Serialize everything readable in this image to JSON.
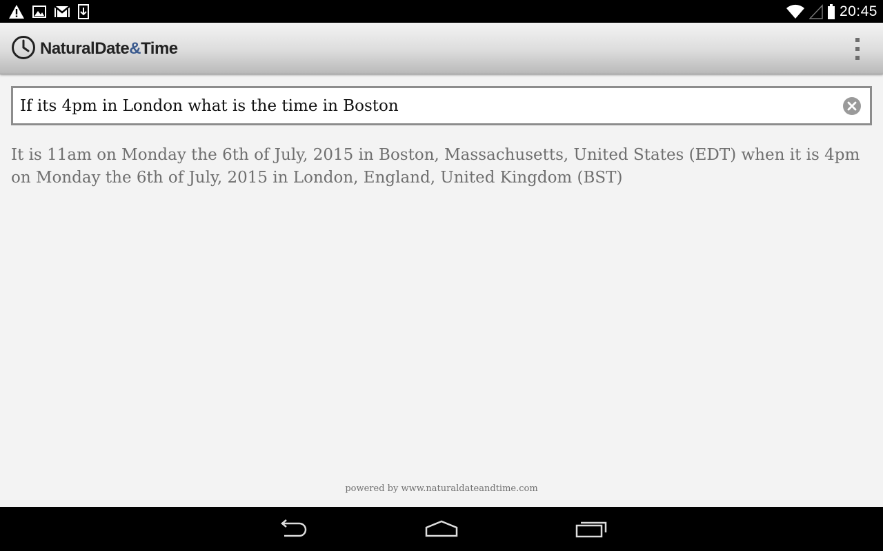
{
  "status_bar": {
    "time": "20:45",
    "left_icons": [
      "warning-icon",
      "image-icon",
      "gmail-icon",
      "download-icon"
    ],
    "right_icons": [
      "wifi-icon",
      "cell-signal-icon",
      "battery-icon"
    ]
  },
  "app_bar": {
    "title_main": "NaturalDate",
    "title_amp": "&",
    "title_end": "Time",
    "logo_icon": "clock-icon",
    "menu_icon": "overflow-menu-icon"
  },
  "search": {
    "value": "If its 4pm in London what is the time in Boston",
    "clear_icon": "clear-icon"
  },
  "result": {
    "text": "It is 11am on Monday the 6th of July, 2015 in Boston, Massachusetts, United States (EDT) when it is 4pm on Monday the 6th of July, 2015 in London, England, United Kingdom (BST)"
  },
  "footer": {
    "powered_by": "powered by www.naturaldateandtime.com"
  },
  "nav_bar": {
    "buttons": [
      "back-icon",
      "home-icon",
      "recents-icon"
    ]
  },
  "colors": {
    "accent_amp": "#3a5a8e",
    "result_text": "#6f6f6f",
    "background": "#f3f3f3"
  }
}
